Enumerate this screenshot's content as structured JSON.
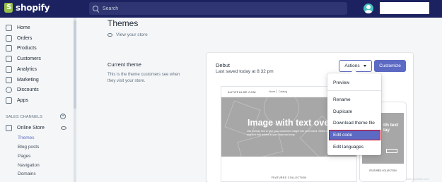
{
  "topbar": {
    "brand": "shopify",
    "search_placeholder": "Search"
  },
  "sidebar": {
    "items": [
      {
        "label": "Home",
        "icon": "home-icon"
      },
      {
        "label": "Orders",
        "icon": "orders-icon"
      },
      {
        "label": "Products",
        "icon": "tag-icon"
      },
      {
        "label": "Customers",
        "icon": "customers-icon"
      },
      {
        "label": "Analytics",
        "icon": "analytics-icon"
      },
      {
        "label": "Marketing",
        "icon": "marketing-icon"
      },
      {
        "label": "Discounts",
        "icon": "discount-icon"
      },
      {
        "label": "Apps",
        "icon": "apps-icon"
      }
    ],
    "section_title": "SALES CHANNELS",
    "channel": "Online Store",
    "sub_items": [
      "Themes",
      "Blog posts",
      "Pages",
      "Navigation",
      "Domains"
    ]
  },
  "main": {
    "title": "Themes",
    "view_store": "View your store",
    "current_theme_title": "Current theme",
    "current_theme_desc": "This is the theme customers see when they visit your store."
  },
  "theme": {
    "name": "Debut",
    "saved": "Last saved today at 8:32 pm",
    "actions_label": "Actions",
    "customize_label": "Customize"
  },
  "preview": {
    "brand": "AUTOPULSE.COM",
    "nav_home": "Home",
    "nav_catalog": "Catalog",
    "hero_title": "Image with text ove",
    "hero_sub": "Use overlay text to give your customers insight into your brand. Select imagery and text that relates to your style and story.",
    "featured": "FEATURED COLLECTION",
    "mobile_hero_title": "ith text\nlay",
    "mobile_featured": "FEATURED COLLECTION"
  },
  "dropdown": {
    "items": [
      "Preview",
      "Rename",
      "Duplicate",
      "Download theme file",
      "Edit code",
      "Edit languages"
    ],
    "highlighted": "Edit code"
  },
  "colors": {
    "topbar": "#1c2260",
    "accent": "#5c6ac4",
    "highlight_border": "#d0021b"
  },
  "watermark": "www.wpsolve.com"
}
